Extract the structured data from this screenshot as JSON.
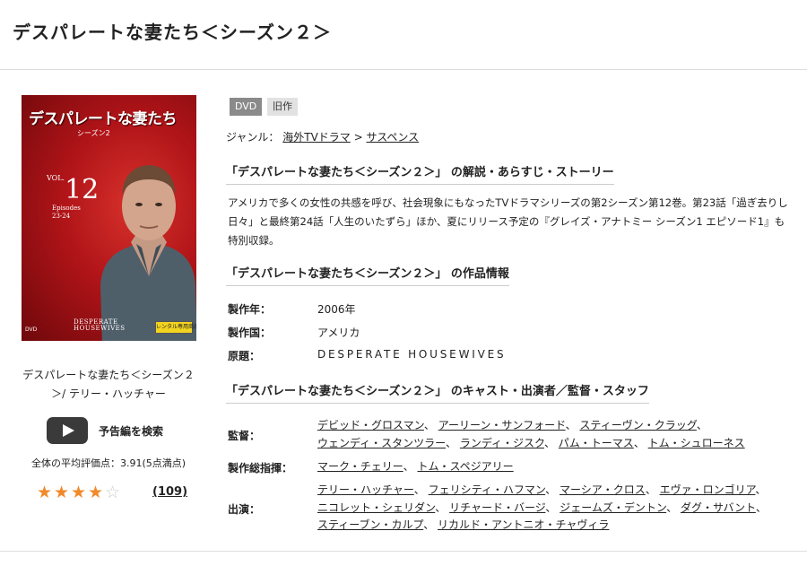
{
  "page_title": "デスパレートな妻たち＜シーズン２＞",
  "cover": {
    "title": "デスパレートな妻たち",
    "season": "シーズン2",
    "vol_prefix": "VOL.",
    "vol_number": "12",
    "episodes_label": "Episodes",
    "episodes": "23-24",
    "logo_line1": "DESPERATE",
    "logo_line2": "HOUSEWIVES",
    "rental_badge": "レンタル専用商品",
    "dvd_mark": "DVD"
  },
  "caption": "デスパレートな妻たち＜シーズン２＞/ テリー・ハッチャー",
  "trailer_label": "予告編を検索",
  "average_rating_text": "全体の平均評価点：3.91(5点満点)",
  "rating": {
    "value": 3.91,
    "max": 5,
    "filled_stars": 4
  },
  "review_count": "(109)",
  "tags": {
    "dvd": "DVD",
    "old": "旧作"
  },
  "genre": {
    "label": "ジャンル：",
    "primary": "海外TVドラマ",
    "separator": ">",
    "secondary": "サスペンス"
  },
  "sections": {
    "synopsis_head": "「デスパレートな妻たち＜シーズン２＞」 の解説・あらすじ・ストーリー",
    "info_head": "「デスパレートな妻たち＜シーズン２＞」 の作品情報",
    "cast_head": "「デスパレートな妻たち＜シーズン２＞」 のキャスト・出演者／監督・スタッフ"
  },
  "synopsis": "アメリカで多くの女性の共感を呼び、社会現象にもなったTVドラマシリーズの第2シーズン第12巻。第23話「過ぎ去りし日々」と最終第24話「人生のいたずら」ほか、夏にリリース予定の『グレイズ・アナトミー シーズン1 エピソード1』も特別収録。",
  "info": {
    "year_label": "製作年：",
    "year": "2006年",
    "country_label": "製作国：",
    "country": "アメリカ",
    "original_label": "原題：",
    "original": "DESPERATE HOUSEWIVES"
  },
  "staff": {
    "director_label": "監督：",
    "directors": [
      "デビッド・グロスマン",
      "アーリーン・サンフォード",
      "スティーヴン・クラッグ",
      "ウェンディ・スタンツラー",
      "ランディ・ジスク",
      "パム・トーマス",
      "トム・シュローネス"
    ],
    "producer_label": "製作総指揮：",
    "producers": [
      "マーク・チェリー",
      "トム・スペジアリー"
    ],
    "cast_label": "出演：",
    "cast": [
      "テリー・ハッチャー",
      "フェリシティ・ハフマン",
      "マーシア・クロス",
      "エヴァ・ロンゴリア",
      "ニコレット・シェリダン",
      "リチャード・バージ",
      "ジェームズ・デントン",
      "ダグ・サバント",
      "スティーブン・カルプ",
      "リカルド・アントニオ・チャヴィラ"
    ],
    "list_separator": "、"
  }
}
